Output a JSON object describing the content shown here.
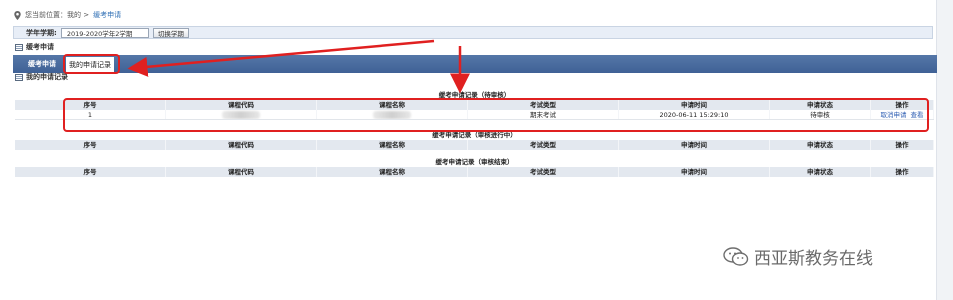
{
  "breadcrumb": {
    "prefix": "您当前位置：我的 >",
    "current": "缓考申请"
  },
  "term": {
    "label": "学年学期:",
    "value": "2019-2020学年2学期",
    "button": "切换学期"
  },
  "sections": {
    "apply": "缓考申请",
    "records": "我的申请记录"
  },
  "tabs": {
    "active": "缓考申请",
    "other": "我的申请记录"
  },
  "columns": [
    "序号",
    "课程代码",
    "课程名称",
    "考试类型",
    "申请时间",
    "申请状态",
    "操作"
  ],
  "tables": [
    {
      "caption": "缓考申请记录（待审核）",
      "rows": [
        {
          "index": "1",
          "exam_type": "期末考试",
          "time": "2020-06-11 15:29:10",
          "status": "待审核",
          "actions": [
            "取消申请",
            "查看"
          ]
        }
      ]
    },
    {
      "caption": "缓考申请记录（审核进行中）",
      "rows": []
    },
    {
      "caption": "缓考申请记录（审核结束）",
      "rows": []
    }
  ],
  "watermark": "西亚斯教务在线",
  "colors": {
    "tabbar": "#4a6ea3",
    "annotation": "#e02020",
    "link": "#2f5fb3"
  }
}
